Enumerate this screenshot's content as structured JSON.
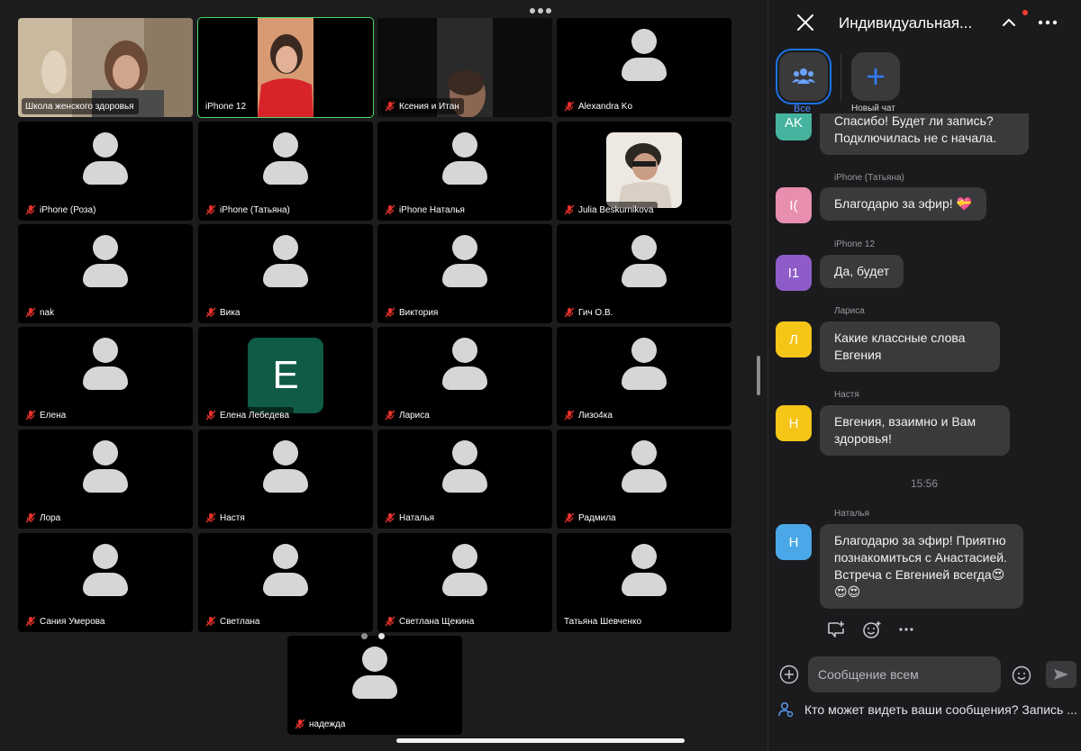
{
  "gallery": {
    "participants": [
      {
        "name": "Школа женского здоровья",
        "muted": false,
        "video": "photo-a"
      },
      {
        "name": "iPhone 12",
        "muted": false,
        "video": "photo-b",
        "active_speaker": true
      },
      {
        "name": "Ксения и Итан",
        "muted": true,
        "video": "photo-c"
      },
      {
        "name": "Alexandra Ko",
        "muted": true
      },
      {
        "name": "iPhone (Роза)",
        "muted": true
      },
      {
        "name": "iPhone (Татьяна)",
        "muted": true
      },
      {
        "name": "iPhone Наталья",
        "muted": true
      },
      {
        "name": "Julia Beskurnikova",
        "muted": true,
        "video": "photo-d"
      },
      {
        "name": "nak",
        "muted": true
      },
      {
        "name": "Вика",
        "muted": true
      },
      {
        "name": "Виктория",
        "muted": true
      },
      {
        "name": "Гич О.В.",
        "muted": true
      },
      {
        "name": "Елена",
        "muted": true
      },
      {
        "name": "Елена Лебедева",
        "muted": true,
        "initial": "E"
      },
      {
        "name": "Лариса",
        "muted": true
      },
      {
        "name": "Лизо4ка",
        "muted": true
      },
      {
        "name": "Лора",
        "muted": true
      },
      {
        "name": "Настя",
        "muted": true
      },
      {
        "name": "Наталья",
        "muted": true
      },
      {
        "name": "Радмила",
        "muted": true
      },
      {
        "name": "Сания Умерова",
        "muted": true
      },
      {
        "name": "Светлана",
        "muted": true
      },
      {
        "name": "Светлана Щекина",
        "muted": true
      },
      {
        "name": "Татьяна Шевченко",
        "muted": false
      },
      {
        "name": "надежда",
        "muted": true
      }
    ],
    "page_indicator": {
      "pages": 2,
      "current": 2
    }
  },
  "chat": {
    "title": "Индивидуальная...",
    "filters": [
      {
        "label": "Все",
        "icon": "people-icon",
        "selected": true
      },
      {
        "label": "Новый чат",
        "icon": "plus-icon",
        "selected": false
      }
    ],
    "messages": [
      {
        "sender": "",
        "avatar_text": "AK",
        "avatar_color": "#45b39d",
        "text": "Спасибо! Будет ли запись? Подключилась не с начала."
      },
      {
        "sender": "iPhone (Татьяна)",
        "avatar_text": "I(",
        "avatar_color": "#e88fb0",
        "text": "Благодарю за эфир! 💝"
      },
      {
        "sender": "iPhone 12",
        "avatar_text": "I1",
        "avatar_color": "#8e5cc9",
        "text": "Да, будет"
      },
      {
        "sender": "Лариса",
        "avatar_text": "Л",
        "avatar_color": "#f5c518",
        "text": "Какие классные слова Евгения"
      },
      {
        "sender": "Настя",
        "avatar_text": "Н",
        "avatar_color": "#f5c518",
        "text": "Евгения, взаимно и Вам здоровья!"
      },
      {
        "sender": "Наталья",
        "avatar_text": "Н",
        "avatar_color": "#4aa8e8",
        "text": "Благодарю за эфир! Приятно познакомиться с Анастасией. Встреча с Евгенией всегда😍😍😍"
      }
    ],
    "timestamp": "15:56",
    "composer_placeholder": "Сообщение всем",
    "visibility_note": "Кто может видеть ваши сообщения? Запись ..."
  },
  "colors": {
    "active_speaker": "#4cd964",
    "accent": "#1a73e8",
    "muted_mic": "#e5312b"
  }
}
